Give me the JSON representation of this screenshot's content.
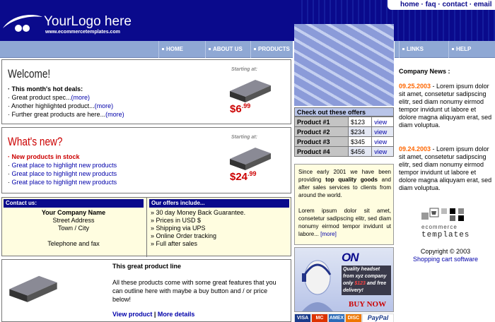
{
  "header": {
    "logo_text": "YourLogo here",
    "logo_sub": "www.ecommercetemplates.com",
    "top_links": [
      "home",
      "faq",
      "contact",
      "email"
    ],
    "separator": "·"
  },
  "nav": {
    "left": [
      "HOME",
      "ABOUT US",
      "PRODUCTS"
    ],
    "right": [
      "LINKS",
      "HELP"
    ]
  },
  "welcome": {
    "title": "Welcome!",
    "subtitle": "This month's hot deals:",
    "items": [
      {
        "text": "Great product spec...",
        "link": "(more)"
      },
      {
        "text": "Another highlighted product...",
        "link": "(more)"
      },
      {
        "text": "Further great products are here...",
        "link": "(more)"
      }
    ],
    "starting": "Starting at:",
    "price_main": "$6",
    "price_cents": ".99"
  },
  "whatsnew": {
    "title": "What's new?",
    "items": [
      "New products in stock",
      "Great place to highlight new products",
      "Great place to highlight new products",
      "Great place to highlight new products"
    ],
    "starting": "Starting at:",
    "price_main": "$24",
    "price_cents": ".99"
  },
  "contact": {
    "header": "Contact us:",
    "company": "Your Company Name",
    "street": "Street Address",
    "town": "Town / City",
    "phone": "Telephone and fax"
  },
  "offers_include": {
    "header": "Our offers include...",
    "items": [
      "30 day Money Back Guarantee.",
      "Prices in USD $",
      "Shipping via UPS",
      "Online Order tracking",
      "Full after sales"
    ]
  },
  "great_line": {
    "title": "This great product line",
    "text": "All these products come with some great features that you can outline here with maybe a buy button and / or price below!",
    "link1": "View product",
    "sep": "|",
    "link2": "More details"
  },
  "offers_table": {
    "header": "Check out these offers",
    "rows": [
      {
        "name": "Product #1",
        "price": "$123",
        "link": "view"
      },
      {
        "name": "Product #2",
        "price": "$234",
        "link": "view"
      },
      {
        "name": "Product #3",
        "price": "$345",
        "link": "view"
      },
      {
        "name": "Product #4",
        "price": "$456",
        "link": "view"
      }
    ]
  },
  "since": {
    "p1a": "Since early 2001 we have been providing ",
    "p1b": "top quality goods",
    "p1c": " and after sales services to clients from around the world.",
    "p2": "Lorem ipsum dolor sit amet, consetetur sadipscing elitr, sed diam nonumy eirmod tempor invidunt ut labore...",
    "more": "[more]"
  },
  "on_offer": {
    "title": "ON OFFER",
    "l1": "Quality headset",
    "l2": "from xyz company",
    "l3a": "only ",
    "l3b": "$123",
    "l3c": " and free",
    "l4": "delivery!",
    "buy": "BUY NOW"
  },
  "cards": [
    "VISA",
    "MC",
    "AMEX",
    "DISC",
    "PayPal"
  ],
  "news": {
    "title": "Company News :",
    "items": [
      {
        "date": "09.25.2003",
        "text": " - Lorem ipsum dolor sit amet, consetetur sadipscing elitr, sed diam nonumy eirmod tempor invidunt ut labore et dolore magna aliquyam erat, sed diam voluptua."
      },
      {
        "date": "09.24.2003",
        "text": " - Lorem ipsum dolor sit amet, consetetur sadipscing elitr, sed diam nonumy eirmod tempor invidunt ut labore et dolore magna aliquyam erat, sed diam voluptua."
      }
    ]
  },
  "footer": {
    "ecom1": "ecommerce",
    "ecom2": "templates",
    "copyright": "Copyright © 2003",
    "link": "Shopping cart software"
  },
  "colors": {
    "brand": "#0a0a8c",
    "accent": "#cc0000",
    "date": "#ff6600"
  }
}
